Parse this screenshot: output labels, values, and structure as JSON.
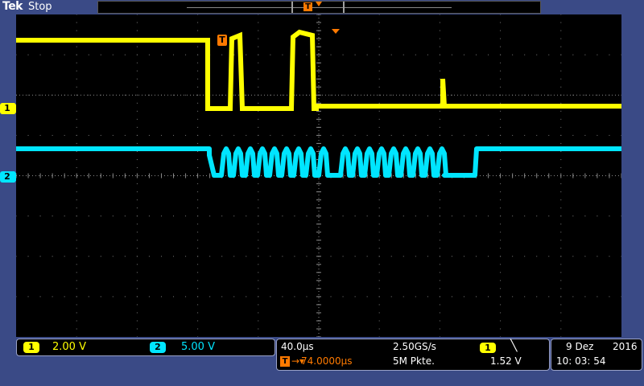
{
  "header": {
    "brand": "Tek",
    "status": "Stop"
  },
  "record_bar": {
    "trigger_icon": "T"
  },
  "waveform": {
    "grid": {
      "h_divisions": 10,
      "v_divisions": 8
    },
    "ch1_color": "#ffff00",
    "ch2_color": "#00e5ff",
    "trigger_color": "#ff7a00",
    "ch1_marker": "1",
    "ch2_marker": "2",
    "trigger_marker": "T"
  },
  "channel_panel": {
    "ch1": {
      "label": "1",
      "scale": "2.00 V"
    },
    "ch2": {
      "label": "2",
      "scale": "5.00 V"
    }
  },
  "horizontal_panel": {
    "timebase": "40.0µs",
    "sample_rate": "2.50GS/s",
    "trigger_source": "1",
    "trigger_slope": "╲",
    "trigger_icon": "T",
    "trigger_arrow": "→▾",
    "trigger_position": "74.0000µs",
    "record_length": "5M Pkte.",
    "trigger_level": "1.52 V"
  },
  "datetime_panel": {
    "date": "9 Dez",
    "year": "2016",
    "time": "10: 03: 54"
  }
}
